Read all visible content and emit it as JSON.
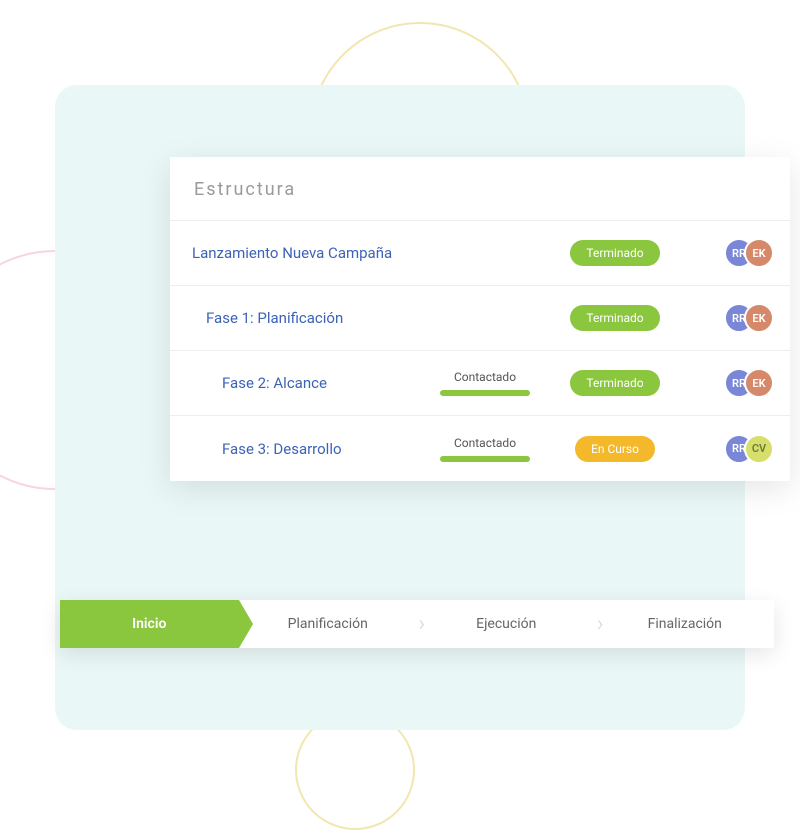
{
  "colors": {
    "accent_green": "#8bc63f",
    "accent_yellow": "#f3b92b",
    "link_blue": "#3d63b7",
    "avatar_blue": "#7a87d6",
    "avatar_orange": "#d6886b",
    "avatar_lime": "#d6df6b"
  },
  "card": {
    "header_label": "Estructura",
    "rows": [
      {
        "title": "Lanzamiento Nueva Campaña",
        "contact": null,
        "status": {
          "label": "Terminado",
          "kind": "green"
        },
        "avatars": [
          "RR",
          "EK"
        ],
        "avatar_colors": [
          "blue",
          "orange"
        ]
      },
      {
        "title": "Fase 1: Planificación",
        "contact": null,
        "status": {
          "label": "Terminado",
          "kind": "green"
        },
        "avatars": [
          "RR",
          "EK"
        ],
        "avatar_colors": [
          "blue",
          "orange"
        ]
      },
      {
        "title": "Fase 2: Alcance",
        "contact": "Contactado",
        "status": {
          "label": "Terminado",
          "kind": "green"
        },
        "avatars": [
          "RR",
          "EK"
        ],
        "avatar_colors": [
          "blue",
          "orange"
        ]
      },
      {
        "title": "Fase 3: Desarrollo",
        "contact": "Contactado",
        "status": {
          "label": "En Curso",
          "kind": "yellow"
        },
        "avatars": [
          "RR",
          "CV"
        ],
        "avatar_colors": [
          "blue",
          "lime"
        ]
      }
    ]
  },
  "stepper": {
    "steps": [
      {
        "label": "Inicio",
        "active": true
      },
      {
        "label": "Planificación",
        "active": false
      },
      {
        "label": "Ejecución",
        "active": false
      },
      {
        "label": "Finalización",
        "active": false
      }
    ]
  }
}
